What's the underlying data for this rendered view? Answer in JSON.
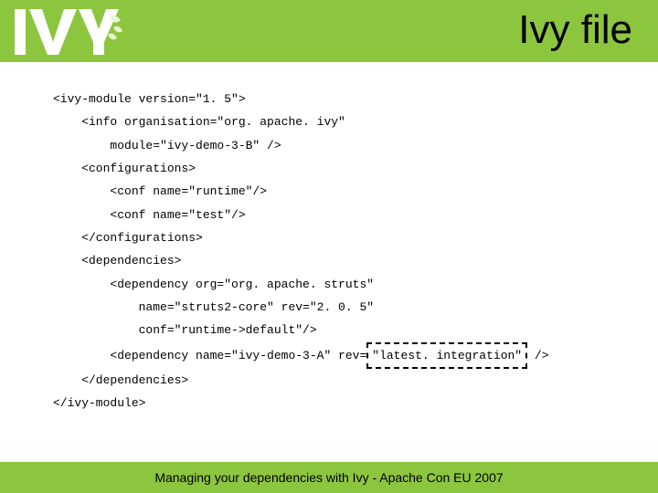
{
  "header": {
    "title": "Ivy file"
  },
  "code": {
    "l1": "<ivy-module version=\"1. 5\">",
    "l2": "    <info organisation=\"org. apache. ivy\"",
    "l3": "        module=\"ivy-demo-3-B\" />",
    "l4": "    <configurations>",
    "l5": "        <conf name=\"runtime\"/>",
    "l6": "        <conf name=\"test\"/>",
    "l7": "    </configurations>",
    "l8": "    <dependencies>",
    "l9": "        <dependency org=\"org. apache. struts\"",
    "l10": "            name=\"struts2-core\" rev=\"2. 0. 5\"",
    "l11": "            conf=\"runtime->default\"/>",
    "l12a": "        <dependency name=\"ivy-demo-3-A\" rev=",
    "l12b": "\"latest. integration\"",
    "l12c": " />",
    "l13": "    </dependencies>",
    "l14": "</ivy-module>"
  },
  "footer": {
    "text": "Managing your dependencies with Ivy - Apache Con EU 2007"
  }
}
